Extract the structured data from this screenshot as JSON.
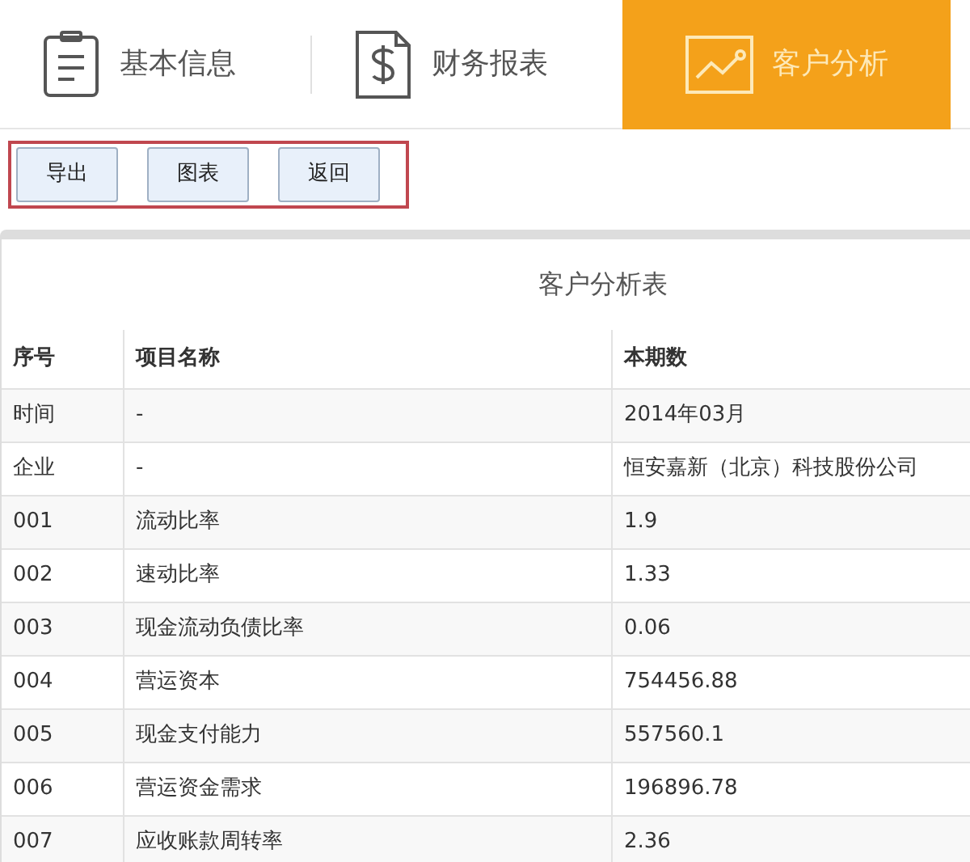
{
  "tabs": [
    {
      "label": "基本信息",
      "kind": "list",
      "selected": false
    },
    {
      "label": "财务报表",
      "kind": "dollar",
      "selected": false
    },
    {
      "label": "客户分析",
      "kind": "chart",
      "selected": true
    }
  ],
  "toolbar": {
    "highlighted": true,
    "buttons": [
      "导出",
      "图表",
      "返回"
    ]
  },
  "table": {
    "title": "客户分析表",
    "columns": [
      "序号",
      "项目名称",
      "本期数"
    ],
    "rows": [
      [
        "时间",
        "-",
        "2014年03月"
      ],
      [
        "企业",
        "-",
        "恒安嘉新（北京）科技股份公司"
      ],
      [
        "001",
        "流动比率",
        "1.9"
      ],
      [
        "002",
        "速动比率",
        "1.33"
      ],
      [
        "003",
        "现金流动负债比率",
        "0.06"
      ],
      [
        "004",
        "营运资本",
        "754456.88"
      ],
      [
        "005",
        "现金支付能力",
        "557560.1"
      ],
      [
        "006",
        "营运资金需求",
        "196896.78"
      ],
      [
        "007",
        "应收账款周转率",
        "2.36"
      ]
    ]
  }
}
